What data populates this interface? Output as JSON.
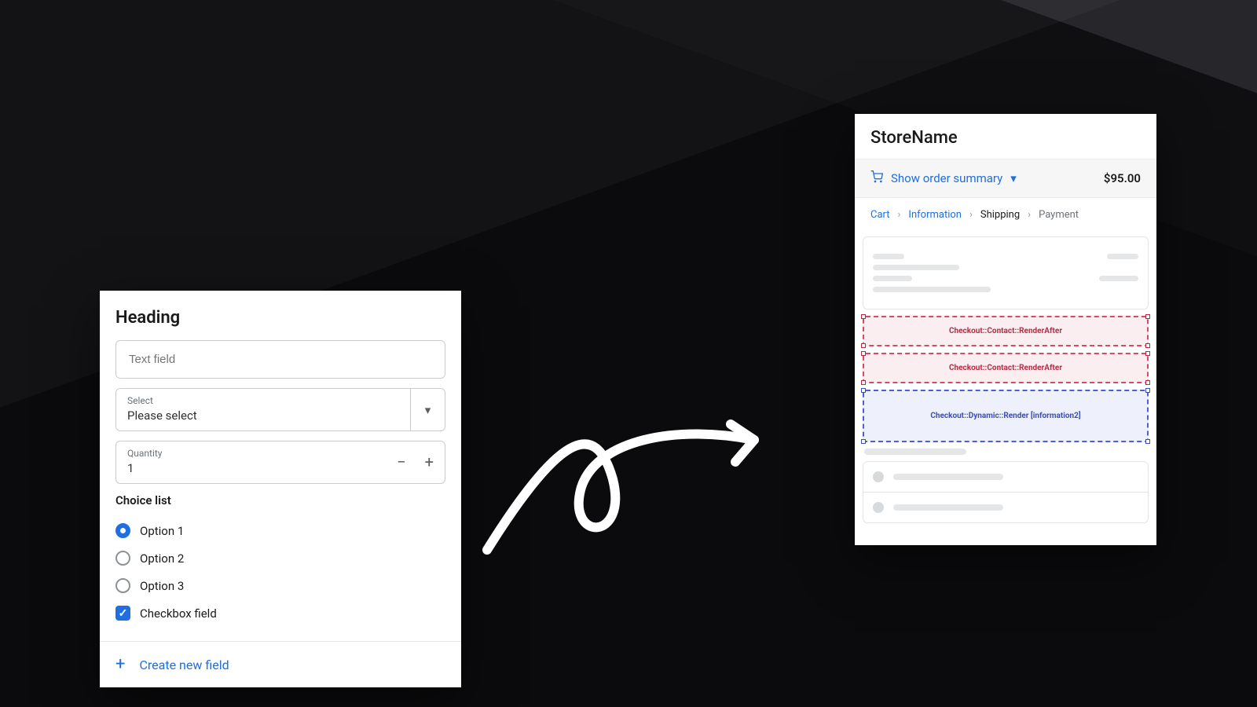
{
  "config": {
    "heading": "Heading",
    "text_field_placeholder": "Text field",
    "select": {
      "label": "Select",
      "value": "Please select"
    },
    "quantity": {
      "label": "Quantity",
      "value": "1"
    },
    "choice_list_title": "Choice list",
    "options": [
      "Option 1",
      "Option 2",
      "Option 3"
    ],
    "selected_option_index": 0,
    "checkbox_label": "Checkbox field",
    "checkbox_checked": true,
    "create_label": "Create new field"
  },
  "checkout": {
    "store_name": "StoreName",
    "summary_toggle": "Show order summary",
    "total": "$95.00",
    "breadcrumbs": [
      "Cart",
      "Information",
      "Shipping",
      "Payment"
    ],
    "active_crumb_index": 2,
    "ext_points": {
      "contact_after_1": "Checkout::Contact::RenderAfter",
      "contact_after_2": "Checkout::Contact::RenderAfter",
      "dynamic": "Checkout::Dynamic::Render [information2]"
    }
  },
  "icons": {
    "chevron_down": "▾",
    "chevron_right": "›",
    "minus": "−",
    "plus": "+",
    "check": "✓"
  }
}
